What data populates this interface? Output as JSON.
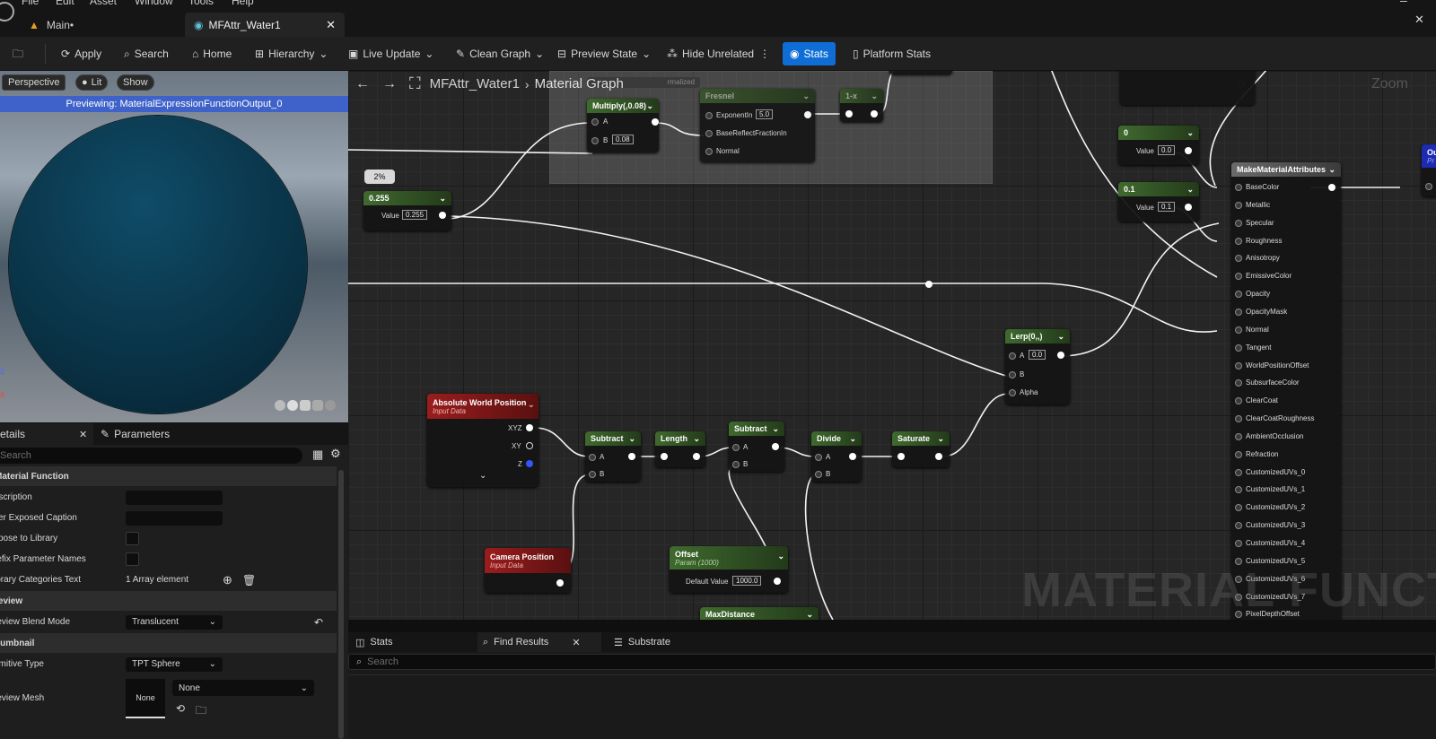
{
  "menu": {
    "file": "File",
    "edit": "Edit",
    "asset": "Asset",
    "window": "Window",
    "tools": "Tools",
    "help": "Help"
  },
  "tabs": [
    {
      "label": "Main•"
    },
    {
      "label": "MFAttr_Water1"
    }
  ],
  "toolbar": {
    "apply": "Apply",
    "search": "Search",
    "home": "Home",
    "hierarchy": "Hierarchy",
    "live_update": "Live Update",
    "clean_graph": "Clean Graph",
    "preview_state": "Preview State",
    "hide_unrelated": "Hide Unrelated",
    "stats": "Stats",
    "platform_stats": "Platform Stats"
  },
  "viewport": {
    "perspective": "Perspective",
    "lit": "Lit",
    "show": "Show",
    "banner": "Previewing: MaterialExpressionFunctionOutput_0"
  },
  "details": {
    "tab_details": "etails",
    "tab_parameters": "Parameters",
    "search_placeholder": "Search",
    "sec_material_function": "Material Function",
    "rows": {
      "description": "escription",
      "user_exposed": "ser Exposed Caption",
      "expose": "xpose to Library",
      "prefix": "refix Parameter Names",
      "categories": "ibrary Categories Text",
      "categories_value": "1 Array element"
    },
    "sec_preview": "review",
    "blend": {
      "name": "review Blend Mode",
      "value": "Translucent"
    },
    "sec_thumbnail": "humbnail",
    "primitive": {
      "name": "rimitive Type",
      "value": "TPT Sphere"
    },
    "preview_mesh": {
      "name": "review Mesh",
      "thumb": "None",
      "value": "None"
    }
  },
  "graph": {
    "breadcrumb": {
      "asset": "MFAttr_Water1",
      "graph": "Material Graph"
    },
    "zoom": "Zoom",
    "comment_badge": "2%",
    "normalized_label": "rmalized",
    "watermark": "MATERIAL FUNCTION",
    "nodes": {
      "multiply": {
        "title": "Multiply(,0.08)",
        "a": "A",
        "b": "B",
        "b_val": "0.08"
      },
      "fresnel": {
        "title": "Fresnel",
        "exp": "ExponentIn",
        "exp_val": "5.0",
        "base": "BaseReflectFractionIn",
        "normal": "Normal"
      },
      "oneminus": {
        "title": "1-x"
      },
      "const255": {
        "title": "0.255",
        "label": "Value",
        "value": "0.255"
      },
      "const0": {
        "title": "0",
        "label": "Value",
        "value": "0.0"
      },
      "const01": {
        "title": "0.1",
        "label": "Value",
        "value": "0.1"
      },
      "mma": {
        "title": "MakeMaterialAttributes",
        "pins": [
          "BaseColor",
          "Metallic",
          "Specular",
          "Roughness",
          "Anisotropy",
          "EmissiveColor",
          "Opacity",
          "OpacityMask",
          "Normal",
          "Tangent",
          "WorldPositionOffset",
          "SubsurfaceColor",
          "ClearCoat",
          "ClearCoatRoughness",
          "AmbientOcclusion",
          "Refraction",
          "CustomizedUVs_0",
          "CustomizedUVs_1",
          "CustomizedUVs_2",
          "CustomizedUVs_3",
          "CustomizedUVs_4",
          "CustomizedUVs_5",
          "CustomizedUVs_6",
          "CustomizedUVs_7",
          "PixelDepthOffset"
        ]
      },
      "output": {
        "title": "Ou",
        "sub": "Pr"
      },
      "lerp": {
        "title": "Lerp(0,,)",
        "a": "A",
        "a_val": "0.0",
        "b": "B",
        "alpha": "Alpha"
      },
      "awp": {
        "title": "Absolute World Position",
        "sub": "Input Data",
        "xyz": "XYZ",
        "xy": "XY",
        "z": "Z"
      },
      "subtract1": {
        "title": "Subtract",
        "a": "A",
        "b": "B"
      },
      "length": {
        "title": "Length"
      },
      "subtract2": {
        "title": "Subtract",
        "a": "A",
        "b": "B"
      },
      "divide": {
        "title": "Divide",
        "a": "A",
        "b": "B"
      },
      "saturate": {
        "title": "Saturate"
      },
      "camera": {
        "title": "Camera Position",
        "sub": "Input Data"
      },
      "offset": {
        "title": "Offset",
        "sub": "Param (1000)",
        "label": "Default Value",
        "value": "1000.0"
      },
      "maxdist": {
        "title": "MaxDistance"
      }
    }
  },
  "bottom": {
    "stats": "Stats",
    "find_results": "Find Results",
    "substrate": "Substrate",
    "search_placeholder": "Search"
  },
  "colors": {
    "accent": "#0f6ed6",
    "banner": "#3e62c9",
    "node_green": "#4f7f38",
    "node_red": "#9a1d1d"
  }
}
